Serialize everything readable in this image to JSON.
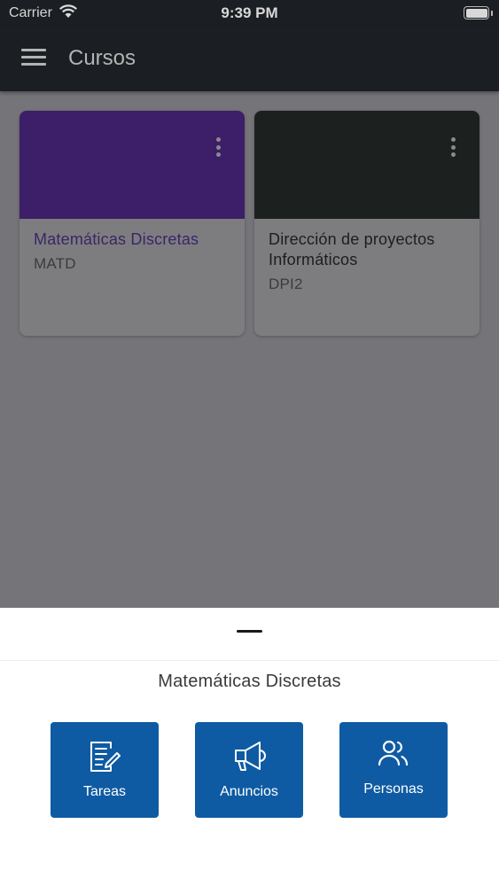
{
  "status_bar": {
    "carrier": "Carrier",
    "time": "9:39 PM"
  },
  "app_bar": {
    "title": "Cursos"
  },
  "courses": [
    {
      "title": "Matemáticas Discretas",
      "code": "MATD",
      "color": "#6a2fbf"
    },
    {
      "title": "Dirección de proyectos Informáticos",
      "code": "DPI2",
      "color": "#2e3a39"
    }
  ],
  "sheet": {
    "title": "Matemáticas Discretas",
    "actions": [
      {
        "label": "Tareas",
        "icon": "assignment-edit-icon"
      },
      {
        "label": "Anuncios",
        "icon": "megaphone-icon"
      },
      {
        "label": "Personas",
        "icon": "people-icon"
      }
    ],
    "accent": "#0f5ba3"
  }
}
